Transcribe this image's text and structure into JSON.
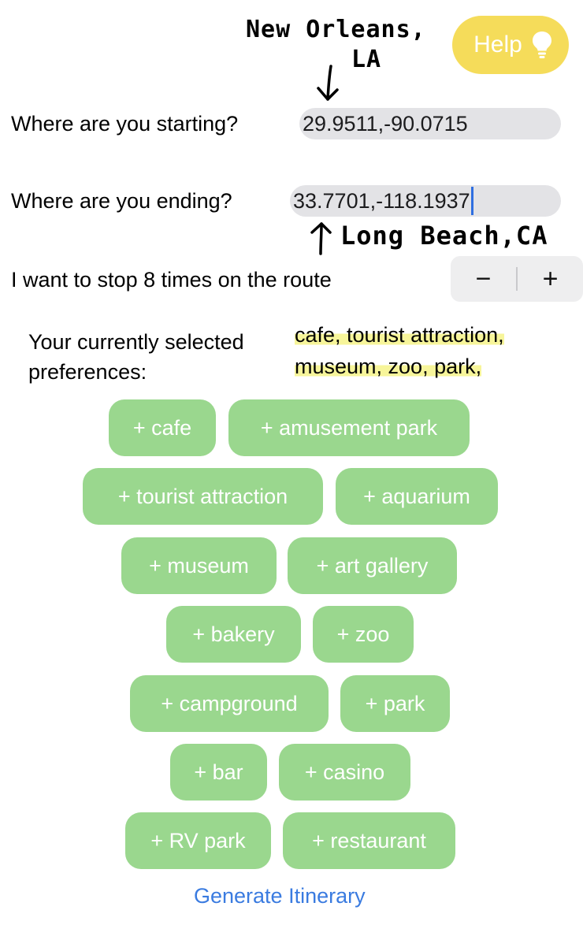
{
  "help_button": {
    "label": "Help",
    "icon": "lightbulb-icon"
  },
  "annotations": {
    "start_city_line1": "New Orleans,",
    "start_city_line2": "LA",
    "end_city": "Long Beach,CA"
  },
  "start": {
    "label": "Where are you starting?",
    "value": "29.9511,-90.0715"
  },
  "end": {
    "label": "Where are you ending?",
    "value": "33.7701,-118.1937"
  },
  "stops": {
    "label": "I want to stop 8 times on the route",
    "minus": "−",
    "plus": "+"
  },
  "preferences": {
    "label_line1": "Your currently selected",
    "label_line2": "preferences:",
    "value_line1": "cafe, tourist  attraction,",
    "value_line2": "museum, zoo, park,"
  },
  "chips": [
    "+ cafe",
    "+ amusement park",
    "+ tourist attraction",
    "+ aquarium",
    "+ museum",
    "+ art gallery",
    "+ bakery",
    "+ zoo",
    "+ campground",
    "+ park",
    "+ bar",
    "+ casino",
    "+ RV park",
    "+ restaurant"
  ],
  "generate_label": "Generate Itinerary",
  "colors": {
    "help_yellow": "#f5dc5a",
    "chip_green": "#9ad78e",
    "link_blue": "#3a7be0",
    "highlight_yellow": "#f7f59a"
  }
}
